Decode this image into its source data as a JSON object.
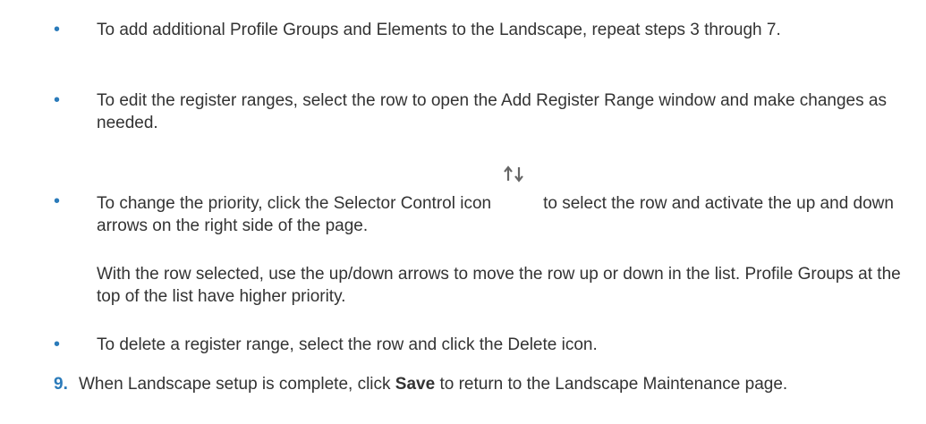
{
  "bullets": {
    "item1": "To add additional Profile Groups and Elements to the Landscape, repeat steps 3 through 7.",
    "item2": "To edit the register ranges, select the row to open the Add Register Range window and make changes as needed.",
    "item3_before": "To change the priority, click the Selector Control icon",
    "item3_after": "to select the row and activate the up and down arrows on the right side of the page.",
    "item3_sub": "With the row selected, use the up/down arrows to move the row up or down in the list. Profile Groups at the top of the list have higher priority.",
    "item4": "To delete a register range, select the row and click the Delete icon."
  },
  "step9": {
    "number": "9.",
    "text_before": "When Landscape setup is complete, click ",
    "bold": "Save",
    "text_after": " to return to the Landscape Maintenance page."
  },
  "icons": {
    "selector_control": "up-down-arrows-icon",
    "bullet_color": "#2b7bba"
  }
}
